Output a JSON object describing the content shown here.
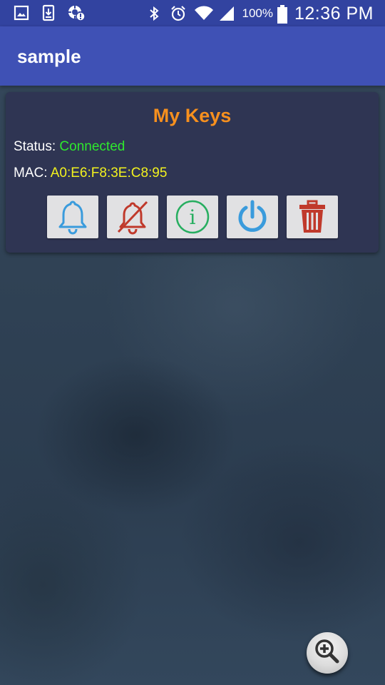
{
  "status_bar": {
    "icons_left": [
      "image-notification-icon",
      "download-notification-icon",
      "sync-error-icon"
    ],
    "icons_right": [
      "bluetooth-icon",
      "alarm-icon",
      "wifi-icon",
      "signal-icon",
      "battery-icon"
    ],
    "battery_percent": "100%",
    "time": "12:36 PM"
  },
  "app_bar": {
    "title": "sample"
  },
  "card": {
    "title": "My Keys",
    "status_label": "Status: ",
    "status_value": "Connected",
    "mac_label": "MAC: ",
    "mac_value": "A0:E6:F8:3E:C8:95",
    "buttons": [
      {
        "icon": "bell-icon",
        "action": "ring"
      },
      {
        "icon": "bell-off-icon",
        "action": "silence"
      },
      {
        "icon": "info-icon",
        "action": "info"
      },
      {
        "icon": "power-icon",
        "action": "power"
      },
      {
        "icon": "trash-icon",
        "action": "delete"
      }
    ]
  },
  "fab": {
    "icon": "zoom-in-icon"
  },
  "colors": {
    "status_bar": "#3243a0",
    "app_bar": "#3f51b5",
    "card_bg": "#2f3553",
    "title": "#f7901e",
    "connected": "#2ee82e",
    "mac": "#f2f21e",
    "bell": "#3a9bdc",
    "bell_off": "#c0392b",
    "info": "#27ae60",
    "power": "#3a9bdc",
    "trash": "#c0392b"
  }
}
